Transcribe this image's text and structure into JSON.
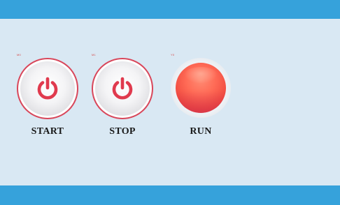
{
  "controls": {
    "start": {
      "tag": "M0",
      "label": "START",
      "icon": "power-icon"
    },
    "stop": {
      "tag": "M1",
      "label": "STOP",
      "icon": "power-icon"
    },
    "run": {
      "tag": "Y0",
      "label": "RUN",
      "state": "on"
    }
  },
  "colors": {
    "accent_bar": "#36a2db",
    "panel_bg": "#d9e8f3",
    "button_ring": "#d9465a",
    "icon_red": "#e03a4e",
    "lamp_on": "#f04a3f",
    "label_text": "#1a1a1a"
  }
}
